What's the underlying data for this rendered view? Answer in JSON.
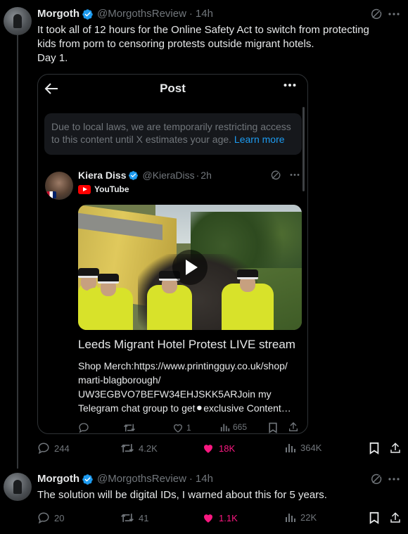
{
  "post1": {
    "name": "Morgoth",
    "handle": "@MorgothsReview",
    "dot": "·",
    "time": "14h",
    "text_line1": "It took all of 12 hours for the Online Safety Act to switch from protecting",
    "text_line2": "kids from porn to censoring protests outside migrant hotels.",
    "text_line3": "Day 1.",
    "card": {
      "title": "Post",
      "restrict_text": "Due to local laws, we are temporarily restricting access to this content until X estimates your age.",
      "restrict_link": "Learn more",
      "inner": {
        "name": "Kiera Diss",
        "handle": "@KieraDiss",
        "dot": "·",
        "time": "2h",
        "source": "YouTube",
        "headline": "Leeds Migrant Hotel Protest LIVE stream",
        "desc_line1": "Shop Merch:https://www.printingguy.co.uk/shop/",
        "desc_line2": "marti-blagborough/",
        "desc_line3": "UW3EGBVO7BEFW34EHJSKK5ARJoin my",
        "desc_line4": "Telegram chat group to get⚫︎exclusive Content…",
        "likes": "1",
        "views": "665"
      }
    },
    "replies": "244",
    "reposts": "4.2K",
    "likes": "18K",
    "views": "364K"
  },
  "post2": {
    "name": "Morgoth",
    "handle": "@MorgothsReview",
    "dot": "·",
    "time": "14h",
    "text": "The solution will be digital IDs, I warned about this for 5 years.",
    "replies": "20",
    "reposts": "41",
    "likes": "1.1K",
    "views": "22K"
  },
  "colors": {
    "background": "#000000",
    "text": "#e7e9ea",
    "muted": "#71767b",
    "accent": "#1d9bf0",
    "like": "#f91880",
    "verified": "#1d9bf0"
  },
  "icons": [
    "verified-badge-icon",
    "grok-icon",
    "more-icon",
    "back-arrow-icon",
    "youtube-icon",
    "play-icon",
    "reply-icon",
    "repost-icon",
    "like-icon",
    "views-icon",
    "bookmark-icon",
    "share-icon"
  ]
}
